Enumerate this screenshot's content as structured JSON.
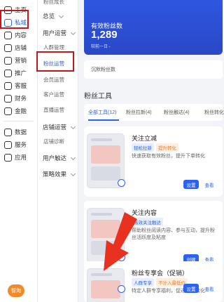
{
  "sidebar": {
    "items": [
      {
        "label": "主页",
        "icon": "home-icon"
      },
      {
        "label": "私域",
        "icon": "private-domain-icon"
      },
      {
        "label": "内容",
        "icon": "content-icon"
      },
      {
        "label": "店铺",
        "icon": "store-icon"
      },
      {
        "label": "营销",
        "icon": "marketing-icon"
      },
      {
        "label": "推广",
        "icon": "promotion-icon"
      },
      {
        "label": "客服",
        "icon": "service-icon"
      },
      {
        "label": "财务",
        "icon": "finance-icon"
      },
      {
        "label": "金融",
        "icon": "finance-service-icon"
      },
      {
        "label": "数据",
        "icon": "data-icon"
      },
      {
        "label": "服务",
        "icon": "services-icon"
      },
      {
        "label": "应用",
        "icon": "apps-icon"
      }
    ],
    "brand": "智淘"
  },
  "subnav": {
    "items": [
      {
        "label": "粉丝成长",
        "kind": "item"
      },
      {
        "label": "总览",
        "kind": "group"
      },
      {
        "label": "用户运营",
        "kind": "group"
      },
      {
        "label": "人群管理",
        "kind": "item"
      },
      {
        "label": "粉丝运营",
        "kind": "item",
        "active": true
      },
      {
        "label": "会员运营",
        "kind": "item"
      },
      {
        "label": "客户运营",
        "kind": "item"
      },
      {
        "label": "直播运营",
        "kind": "item"
      },
      {
        "label": "店铺运营",
        "kind": "group"
      },
      {
        "label": "店铺诊断",
        "kind": "item"
      },
      {
        "label": "用户触达",
        "kind": "group"
      },
      {
        "label": "策略效果",
        "kind": "group"
      }
    ]
  },
  "hero": {
    "title": "有效粉丝数",
    "value": "1,289",
    "sub": "较前一日 -"
  },
  "sleep_fans": {
    "label": "沉默粉丝数"
  },
  "tools": {
    "title": "粉丝工具",
    "tabs": [
      "全部工具(12)",
      "粉丝拉新(4)",
      "粉丝触达(4)",
      "粉丝转化"
    ]
  },
  "cards": [
    {
      "title": "关注立减",
      "tags": [
        {
          "text": "轻松拉新",
          "color": "blue"
        },
        {
          "text": "提升转化",
          "color": "orange"
        }
      ],
      "desc": "快速获取有效粉丝，提升下单转化",
      "primary": "设置",
      "secondary": "查看"
    },
    {
      "title": "关注内容",
      "tags": [
        {
          "text": "高效关注触达",
          "color": "blue"
        }
      ],
      "desc": "帮助粉丝阅读内容、参与互动，提升粉丝活跃度及粘度",
      "primary": "创建",
      "secondary": "查看"
    },
    {
      "title": "粉丝专享会（促销）",
      "tags": [
        {
          "text": "人群专享",
          "color": "blue"
        },
        {
          "text": "不计入最低价",
          "color": "orange"
        }
      ],
      "desc": "特定人群专享福利，促进成交转化",
      "primary": "设置",
      "secondary": "查看"
    }
  ],
  "colors": {
    "accent": "#2b62f0",
    "highlight": "#c5161d",
    "arrow": "#e8311e"
  }
}
